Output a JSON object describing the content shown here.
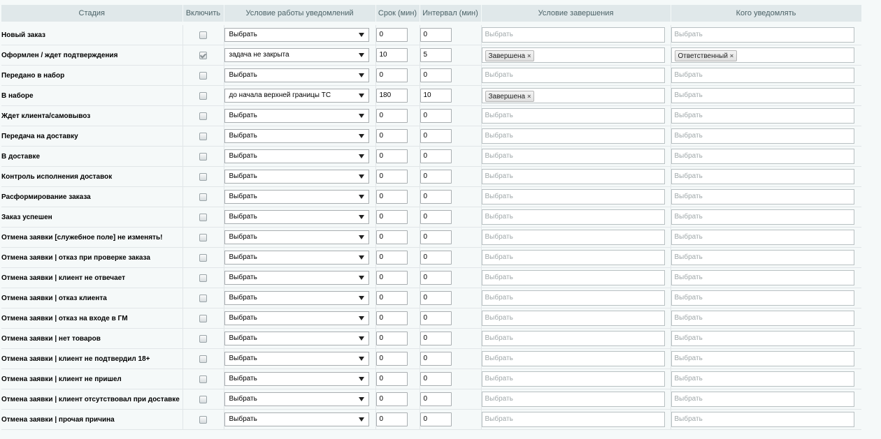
{
  "headers": {
    "stage": "Стадия",
    "enable": "Включить",
    "condition": "Условие работы уведомлений",
    "term": "Срок (мин)",
    "interval": "Интервал (мин)",
    "completion": "Условие завершения",
    "notify": "Кого уведомлять"
  },
  "placeholder": "Выбрать",
  "tag_remove_glyph": "×",
  "rows": [
    {
      "stage": "Новый заказ",
      "enabled": false,
      "condition": "Выбрать",
      "term": "0",
      "interval": "0",
      "completion": "",
      "notify": ""
    },
    {
      "stage": "Оформлен / ждет подтверждения",
      "enabled": true,
      "condition": "задача не закрыта",
      "term": "10",
      "interval": "5",
      "completion": "Завершена",
      "notify": "Ответственный"
    },
    {
      "stage": "Передано в набор",
      "enabled": false,
      "condition": "Выбрать",
      "term": "0",
      "interval": "0",
      "completion": "",
      "notify": ""
    },
    {
      "stage": "В наборе",
      "enabled": false,
      "condition": "до начала верхней границы ТС",
      "term": "180",
      "interval": "10",
      "completion": "Завершена",
      "notify": ""
    },
    {
      "stage": "Ждет клиента/самовывоз",
      "enabled": false,
      "condition": "Выбрать",
      "term": "0",
      "interval": "0",
      "completion": "",
      "notify": ""
    },
    {
      "stage": "Передача на доставку",
      "enabled": false,
      "condition": "Выбрать",
      "term": "0",
      "interval": "0",
      "completion": "",
      "notify": ""
    },
    {
      "stage": "В доставке",
      "enabled": false,
      "condition": "Выбрать",
      "term": "0",
      "interval": "0",
      "completion": "",
      "notify": ""
    },
    {
      "stage": "Контроль исполнения доставок",
      "enabled": false,
      "condition": "Выбрать",
      "term": "0",
      "interval": "0",
      "completion": "",
      "notify": ""
    },
    {
      "stage": "Расформирование заказа",
      "enabled": false,
      "condition": "Выбрать",
      "term": "0",
      "interval": "0",
      "completion": "",
      "notify": ""
    },
    {
      "stage": "Заказ успешен",
      "enabled": false,
      "condition": "Выбрать",
      "term": "0",
      "interval": "0",
      "completion": "",
      "notify": ""
    },
    {
      "stage": "Отмена заявки [служебное поле] не изменять!",
      "enabled": false,
      "condition": "Выбрать",
      "term": "0",
      "interval": "0",
      "completion": "",
      "notify": ""
    },
    {
      "stage": "Отмена заявки | отказ при проверке заказа",
      "enabled": false,
      "condition": "Выбрать",
      "term": "0",
      "interval": "0",
      "completion": "",
      "notify": ""
    },
    {
      "stage": "Отмена заявки | клиент не отвечает",
      "enabled": false,
      "condition": "Выбрать",
      "term": "0",
      "interval": "0",
      "completion": "",
      "notify": ""
    },
    {
      "stage": "Отмена заявки | отказ клиента",
      "enabled": false,
      "condition": "Выбрать",
      "term": "0",
      "interval": "0",
      "completion": "",
      "notify": ""
    },
    {
      "stage": "Отмена заявки | отказ на входе в ГМ",
      "enabled": false,
      "condition": "Выбрать",
      "term": "0",
      "interval": "0",
      "completion": "",
      "notify": ""
    },
    {
      "stage": "Отмена заявки | нет товаров",
      "enabled": false,
      "condition": "Выбрать",
      "term": "0",
      "interval": "0",
      "completion": "",
      "notify": ""
    },
    {
      "stage": "Отмена заявки | клиент не подтвердил 18+",
      "enabled": false,
      "condition": "Выбрать",
      "term": "0",
      "interval": "0",
      "completion": "",
      "notify": ""
    },
    {
      "stage": "Отмена заявки | клиент не пришел",
      "enabled": false,
      "condition": "Выбрать",
      "term": "0",
      "interval": "0",
      "completion": "",
      "notify": ""
    },
    {
      "stage": "Отмена заявки | клиент отсутствовал при доставке",
      "enabled": false,
      "condition": "Выбрать",
      "term": "0",
      "interval": "0",
      "completion": "",
      "notify": ""
    },
    {
      "stage": "Отмена заявки | прочая причина",
      "enabled": false,
      "condition": "Выбрать",
      "term": "0",
      "interval": "0",
      "completion": "",
      "notify": ""
    }
  ]
}
